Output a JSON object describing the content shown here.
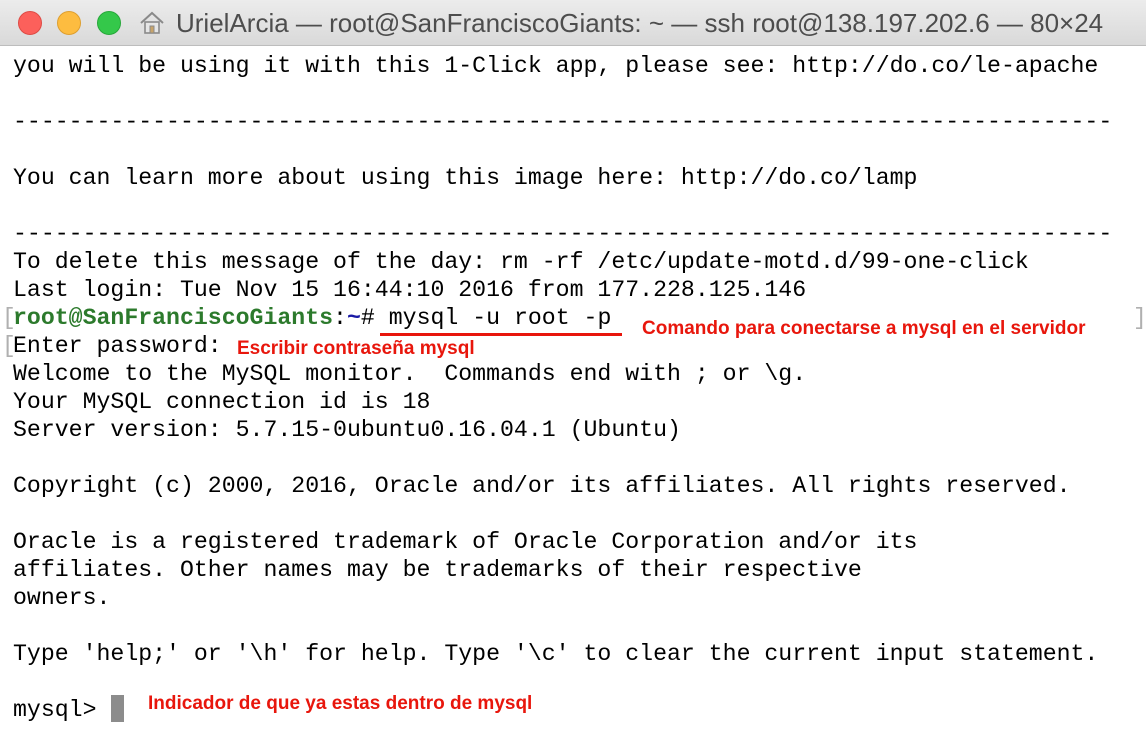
{
  "window": {
    "title": "UrielArcia — root@SanFranciscoGiants: ~ — ssh root@138.197.202.6 — 80×24",
    "icon": "home-icon"
  },
  "terminal": {
    "line1": "you will be using it with this 1-Click app, please see: http://do.co/le-apache",
    "separator": "-------------------------------------------------------------------------------",
    "line_learn": "You can learn more about using this image here: http://do.co/lamp",
    "line_delete": "To delete this message of the day: rm -rf /etc/update-motd.d/99-one-click",
    "line_login": "Last login: Tue Nov 15 16:44:10 2016 from 177.228.125.146",
    "prompt_user": "root@SanFranciscoGiants",
    "prompt_colon": ":",
    "prompt_path": "~",
    "prompt_hash": "# ",
    "command": "mysql -u root -p",
    "enter_password": "Enter password: ",
    "welcome": "Welcome to the MySQL monitor.  Commands end with ; or \\g.",
    "connection_id": "Your MySQL connection id is 18",
    "server_version": "Server version: 5.7.15-0ubuntu0.16.04.1 (Ubuntu)",
    "copyright": "Copyright (c) 2000, 2016, Oracle and/or its affiliates. All rights reserved.",
    "trademark1": "Oracle is a registered trademark of Oracle Corporation and/or its",
    "trademark2": "affiliates. Other names may be trademarks of their respective",
    "trademark3": "owners.",
    "help": "Type 'help;' or '\\h' for help. Type '\\c' to clear the current input statement.",
    "mysql_prompt": "mysql> "
  },
  "annotations": {
    "command_note": "Comando para conectarse a mysql en el servidor",
    "password_note": "Escribir contraseña mysql",
    "prompt_note": "Indicador de que ya estas dentro de mysql",
    "color": "#e8160c"
  },
  "colors": {
    "prompt_user": "#2c7a2c",
    "prompt_path": "#1a1aa6",
    "close": "#fc605b",
    "minimize": "#fdbc40",
    "maximize": "#34c84a"
  }
}
